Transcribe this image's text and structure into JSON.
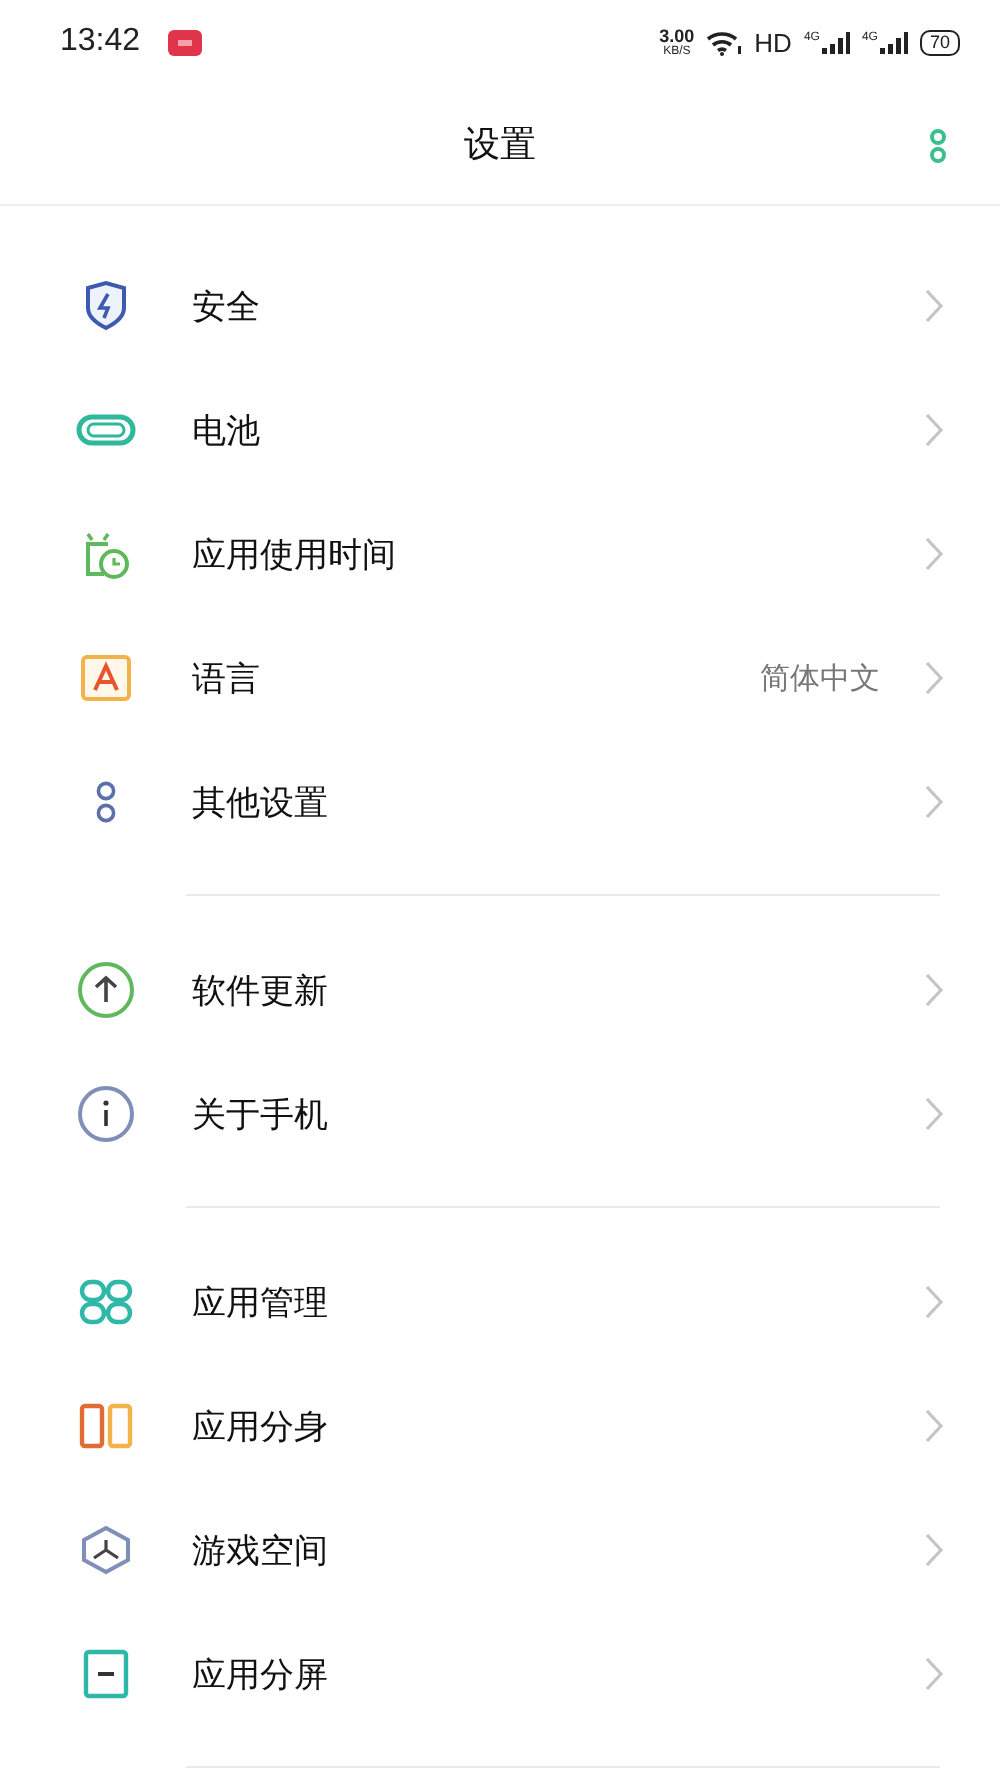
{
  "status_bar": {
    "time": "13:42",
    "speed": "3.00",
    "speed_unit": "KB/S",
    "hd": "HD",
    "networks": [
      "4G",
      "4G"
    ],
    "battery": "70"
  },
  "header": {
    "title": "设置"
  },
  "sections": [
    {
      "items": [
        {
          "label": "安全"
        },
        {
          "label": "电池"
        },
        {
          "label": "应用使用时间"
        },
        {
          "label": "语言",
          "value": "简体中文"
        },
        {
          "label": "其他设置"
        }
      ]
    },
    {
      "items": [
        {
          "label": "软件更新"
        },
        {
          "label": "关于手机"
        }
      ]
    },
    {
      "items": [
        {
          "label": "应用管理"
        },
        {
          "label": "应用分身"
        },
        {
          "label": "游戏空间"
        },
        {
          "label": "应用分屏"
        }
      ]
    }
  ]
}
